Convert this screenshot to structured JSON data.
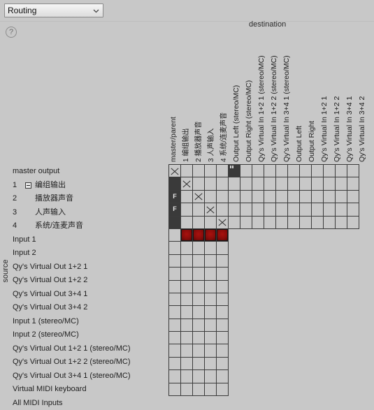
{
  "window": {
    "background_color": "#c8c8c8",
    "accent_red": "#8b0d0b"
  },
  "toolbar": {
    "mode_select_value": "Routing",
    "mode_select_options": [
      "Routing"
    ],
    "chevron_icon": "chevron-down-icon",
    "help_label": "?"
  },
  "axes": {
    "destination_label": "destination",
    "source_label": "source"
  },
  "columns": [
    {
      "label": "master/parent",
      "cjk": false
    },
    {
      "label": "1  编组输出",
      "cjk": true
    },
    {
      "label": "2  播放器声音",
      "cjk": true
    },
    {
      "label": "3  人声输入",
      "cjk": true
    },
    {
      "label": "4  系统/连麦声音",
      "cjk": true
    },
    {
      "label": "Output Left (stereo/MC)",
      "cjk": false
    },
    {
      "label": "Output Right (stereo/MC)",
      "cjk": false
    },
    {
      "label": "Qy's Virtual In 1+2 1 (stereo/MC)",
      "cjk": false
    },
    {
      "label": "Qy's Virtual In 1+2 2 (stereo/MC)",
      "cjk": false
    },
    {
      "label": "Qy's Virtual In 3+4 1 (stereo/MC)",
      "cjk": false
    },
    {
      "label": "Output Left",
      "cjk": false
    },
    {
      "label": "Output Right",
      "cjk": false
    },
    {
      "label": "Qy's Virtual In 1+2 1",
      "cjk": false
    },
    {
      "label": "Qy's Virtual In 1+2 2",
      "cjk": false
    },
    {
      "label": "Qy's Virtual In 3+4 1",
      "cjk": false
    },
    {
      "label": "Qy's Virtual In 3+4 2",
      "cjk": false
    }
  ],
  "rows": [
    {
      "num": "",
      "indent": 0,
      "tree": false,
      "label": "master output",
      "cjk": false,
      "span": 16
    },
    {
      "num": "1",
      "indent": 0,
      "tree": true,
      "label": "编组输出",
      "cjk": true,
      "span": 16
    },
    {
      "num": "2",
      "indent": 1,
      "tree": false,
      "label": "播放器声音",
      "cjk": true,
      "span": 16
    },
    {
      "num": "3",
      "indent": 1,
      "tree": false,
      "label": "人声输入",
      "cjk": true,
      "span": 16
    },
    {
      "num": "4",
      "indent": 1,
      "tree": false,
      "label": "系统/连麦声音",
      "cjk": true,
      "span": 16
    },
    {
      "num": "",
      "indent": 0,
      "tree": false,
      "label": "Input 1",
      "cjk": false,
      "span": 5
    },
    {
      "num": "",
      "indent": 0,
      "tree": false,
      "label": "Input 2",
      "cjk": false,
      "span": 5
    },
    {
      "num": "",
      "indent": 0,
      "tree": false,
      "label": "Qy's Virtual Out 1+2 1",
      "cjk": false,
      "span": 5
    },
    {
      "num": "",
      "indent": 0,
      "tree": false,
      "label": "Qy's Virtual Out 1+2 2",
      "cjk": false,
      "span": 5
    },
    {
      "num": "",
      "indent": 0,
      "tree": false,
      "label": "Qy's Virtual Out 3+4 1",
      "cjk": false,
      "span": 5
    },
    {
      "num": "",
      "indent": 0,
      "tree": false,
      "label": "Qy's Virtual Out 3+4 2",
      "cjk": false,
      "span": 5
    },
    {
      "num": "",
      "indent": 0,
      "tree": false,
      "label": "Input 1 (stereo/MC)",
      "cjk": false,
      "span": 5
    },
    {
      "num": "",
      "indent": 0,
      "tree": false,
      "label": "Input 2 (stereo/MC)",
      "cjk": false,
      "span": 5
    },
    {
      "num": "",
      "indent": 0,
      "tree": false,
      "label": "Qy's Virtual Out 1+2 1 (stereo/MC)",
      "cjk": false,
      "span": 5
    },
    {
      "num": "",
      "indent": 0,
      "tree": false,
      "label": "Qy's Virtual Out 1+2 2 (stereo/MC)",
      "cjk": false,
      "span": 5
    },
    {
      "num": "",
      "indent": 0,
      "tree": false,
      "label": "Qy's Virtual Out 3+4 1 (stereo/MC)",
      "cjk": false,
      "span": 5
    },
    {
      "num": "",
      "indent": 0,
      "tree": false,
      "label": "Virtual MIDI keyboard",
      "cjk": false,
      "span": 5
    },
    {
      "num": "",
      "indent": 0,
      "tree": false,
      "label": "All MIDI Inputs",
      "cjk": false,
      "span": 5
    }
  ],
  "matrix": [
    [
      "x",
      "",
      "",
      "",
      "",
      "meter",
      "",
      "",
      "",
      "",
      "",
      "",
      "",
      "",
      "",
      ""
    ],
    [
      "dark",
      "x",
      "",
      "",
      "",
      "",
      "",
      "",
      "",
      "",
      "",
      "",
      "",
      "",
      "",
      ""
    ],
    [
      "f",
      "",
      "x",
      "",
      "",
      "",
      "",
      "",
      "",
      "",
      "",
      "",
      "",
      "",
      "",
      ""
    ],
    [
      "f",
      "",
      "",
      "x",
      "",
      "",
      "",
      "",
      "",
      "",
      "",
      "",
      "",
      "",
      "",
      ""
    ],
    [
      "dark",
      "",
      "",
      "",
      "x",
      "",
      "",
      "",
      "",
      "",
      "",
      "",
      "",
      "",
      "",
      ""
    ],
    [
      "",
      "red",
      "red",
      "red",
      "red"
    ],
    [
      "",
      "",
      "",
      "",
      ""
    ],
    [
      "",
      "",
      "",
      "",
      ""
    ],
    [
      "",
      "",
      "",
      "",
      ""
    ],
    [
      "",
      "",
      "",
      "",
      ""
    ],
    [
      "",
      "",
      "",
      "",
      ""
    ],
    [
      "",
      "",
      "",
      "",
      ""
    ],
    [
      "",
      "",
      "",
      "",
      ""
    ],
    [
      "",
      "",
      "",
      "",
      ""
    ],
    [
      "",
      "",
      "",
      "",
      ""
    ],
    [
      "",
      "",
      "",
      "",
      ""
    ],
    [
      "",
      "",
      "",
      "",
      ""
    ],
    [
      "",
      "",
      "",
      "",
      ""
    ]
  ],
  "cell_marks": {
    "x": "connection-cross-icon",
    "dark": "connection-filled-icon",
    "f": "F",
    "red": "connection-active-icon",
    "meter": "level-meter-icon"
  }
}
